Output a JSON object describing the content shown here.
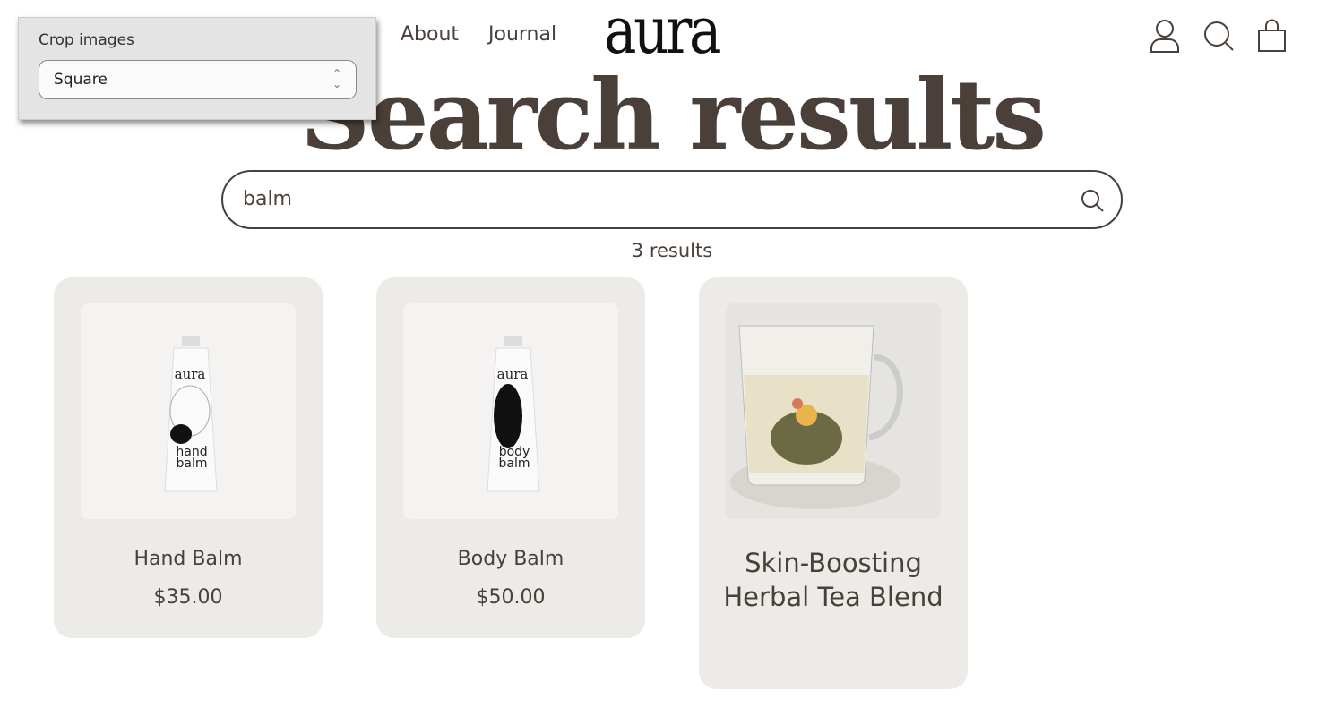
{
  "header": {
    "nav": [
      {
        "label": "About"
      },
      {
        "label": "Journal"
      }
    ],
    "logo": "aura",
    "icons": [
      "account-icon",
      "search-icon",
      "cart-icon"
    ]
  },
  "page": {
    "title": "Search results",
    "search_value": "balm",
    "search_placeholder": "Search",
    "results_count": "3 results"
  },
  "products": [
    {
      "name": "Hand Balm",
      "price": "$35.00",
      "image_text": "aura hand balm"
    },
    {
      "name": "Body Balm",
      "price": "$50.00",
      "image_text": "aura body balm"
    },
    {
      "name": "Skin-Boosting Herbal Tea Blend"
    }
  ],
  "editor_panel": {
    "label": "Crop images",
    "selected": "Square"
  }
}
